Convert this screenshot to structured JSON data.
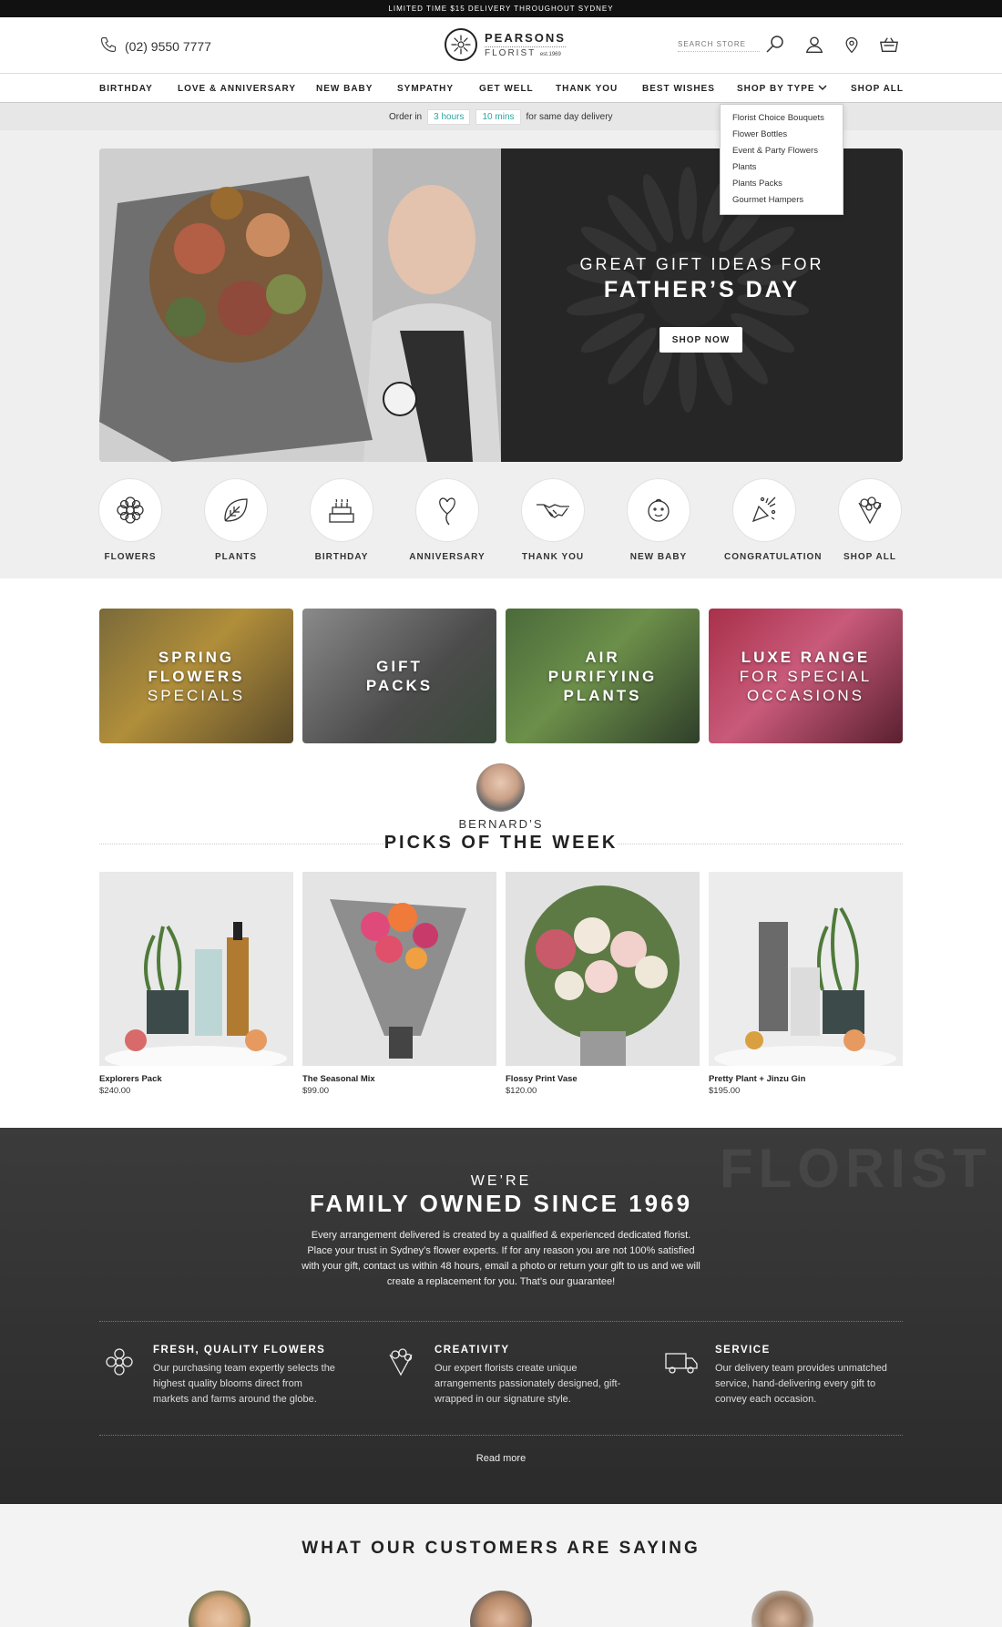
{
  "topbar": {
    "text": "LIMITED TIME $15 DELIVERY THROUGHOUT SYDNEY"
  },
  "header": {
    "phone": "(02) 9550 7777",
    "logo_line1": "PEARSONS",
    "logo_line2": "FLORIST",
    "logo_est": "est.1969",
    "search_placeholder": "SEARCH STORE",
    "icons": [
      "phone-icon",
      "search-icon",
      "account-icon",
      "location-icon",
      "basket-icon"
    ]
  },
  "nav": {
    "items": [
      "BIRTHDAY",
      "LOVE & ANNIVERSARY",
      "NEW BABY",
      "SYMPATHY",
      "GET WELL",
      "THANK YOU",
      "BEST WISHES",
      "SHOP BY TYPE",
      "SHOP ALL"
    ],
    "dropdown": [
      "Florist Choice Bouquets",
      "Flower Bottles",
      "Event & Party Flowers",
      "Plants",
      "Plants Packs",
      "Gourmet Hampers"
    ]
  },
  "delivery": {
    "prefix": "Order in",
    "hours": "3 hours",
    "mins": "10 mins",
    "suffix": "for same day delivery"
  },
  "hero": {
    "subtitle": "GREAT GIFT IDEAS FOR",
    "title": "FATHER’S DAY",
    "button": "SHOP NOW"
  },
  "categories": [
    {
      "label": "FLOWERS",
      "icon": "flower-icon"
    },
    {
      "label": "PLANTS",
      "icon": "leaf-icon"
    },
    {
      "label": "BIRTHDAY",
      "icon": "cake-icon"
    },
    {
      "label": "ANNIVERSARY",
      "icon": "heart-balloon-icon"
    },
    {
      "label": "THANK YOU",
      "icon": "handshake-icon"
    },
    {
      "label": "NEW BABY",
      "icon": "baby-icon"
    },
    {
      "label": "CONGRATULATION",
      "icon": "party-popper-icon"
    },
    {
      "label": "SHOP ALL",
      "icon": "bouquet-icon"
    }
  ],
  "tiles": [
    {
      "line1": "SPRING",
      "line2": "FLOWERS",
      "line3": "SPECIALS"
    },
    {
      "line1": "GIFT",
      "line2": "PACKS",
      "line3": ""
    },
    {
      "line1": "AIR",
      "line2": "PURIFYING",
      "line3": "PLANTS"
    },
    {
      "line1": "LUXE RANGE",
      "line2": "FOR SPECIAL",
      "line3": "OCCASIONS"
    }
  ],
  "picks": {
    "subtitle": "BERNARD’S",
    "title": "PICKS OF THE WEEK",
    "products": [
      {
        "name": "Explorers Pack",
        "price": "$240.00"
      },
      {
        "name": "The Seasonal Mix",
        "price": "$99.00"
      },
      {
        "name": "Flossy Print Vase",
        "price": "$120.00"
      },
      {
        "name": "Pretty Plant + Jinzu Gin",
        "price": "$195.00"
      }
    ]
  },
  "family": {
    "subtitle": "WE’RE",
    "title": "FAMILY OWNED SINCE 1969",
    "body": "Every arrangement delivered is created by a qualified & experienced dedicated florist. Place your trust in Sydney’s flower experts. If for any reason you are not 100% satisfied with your gift, contact us within 48 hours, email a photo or return your gift to us and we will create a replacement for you. That’s our guarantee!",
    "bg_text": "FLORIST",
    "features": [
      {
        "title": "FRESH, QUALITY FLOWERS",
        "text": "Our purchasing team expertly selects the highest quality blooms direct from markets and farms around the globe.",
        "icon": "flower-icon"
      },
      {
        "title": "CREATIVITY",
        "text": "Our expert florists create unique arrangements passionately designed, gift-wrapped in our signature style.",
        "icon": "bouquet-icon"
      },
      {
        "title": "SERVICE",
        "text": "Our delivery team provides unmatched service, hand-delivering every gift to convey each occasion.",
        "icon": "delivery-truck-icon"
      }
    ],
    "read_more": "Read more"
  },
  "testimonials": {
    "title": "WHAT OUR CUSTOMERS ARE SAYING"
  },
  "colors": {
    "accent": "#2aa7a0",
    "dark": "#262626",
    "topbar": "#111111"
  }
}
